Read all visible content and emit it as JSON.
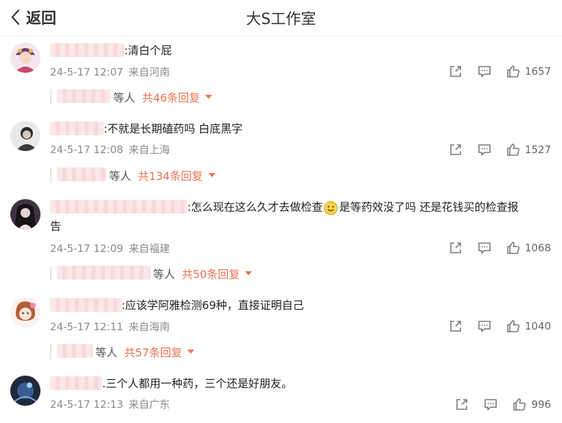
{
  "header": {
    "back_label": "返回",
    "title": "大S工作室"
  },
  "comments": [
    {
      "text": ":清白个屁",
      "time": "24-5-17 12:07",
      "location": "来自河南",
      "likes": "1657",
      "replies_suffix": "等人",
      "replies_link": "共46条回复"
    },
    {
      "text": ":不就是长期磕药吗 白底黑字",
      "time": "24-5-17 12:08",
      "location": "来自上海",
      "likes": "1527",
      "replies_suffix": "等人",
      "replies_link": "共134条回复"
    },
    {
      "text_a": ":怎么现在这么久才去做检查",
      "text_b": "是等药效没了吗 还是花钱买的检查报",
      "text_c": "告",
      "time": "24-5-17 12:09",
      "location": "来自福建",
      "likes": "1068",
      "replies_suffix": "等人",
      "replies_link": "共50条回复"
    },
    {
      "text": ":应该学阿雅检测69种，直接证明自己",
      "time": "24-5-17 12:11",
      "location": "来自海南",
      "likes": "1040",
      "replies_suffix": "等人",
      "replies_link": "共57条回复"
    },
    {
      "text": ".三个人都用一种药，三个还是好朋友。",
      "time": "24-5-17 12:13",
      "location": "来自广东",
      "likes": "996"
    }
  ],
  "colors": {
    "accent": "#eb7350",
    "meta": "#8a8a8a",
    "divider": "#e5e5e5"
  },
  "icons": [
    "back-chevron-icon",
    "share-icon",
    "comment-icon",
    "like-icon",
    "caret-down-icon",
    "smiley-emoji-icon"
  ]
}
